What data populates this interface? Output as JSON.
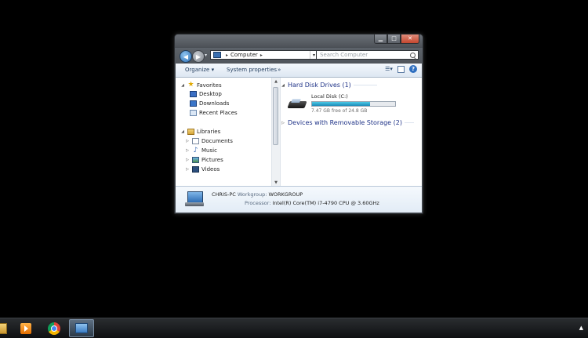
{
  "window": {
    "caption_buttons": {
      "minimize": "▁",
      "maximize": "□",
      "close": "✕"
    },
    "address": {
      "location": "Computer",
      "sep1": "▸",
      "sep2": "▸",
      "dropdown": "▾"
    },
    "search": {
      "placeholder": "Search Computer"
    },
    "toolbar": {
      "organize": "Organize ▾",
      "system_properties": "System properties",
      "more": "»"
    },
    "nav": {
      "favorites": {
        "label": "Favorites",
        "items": [
          "Desktop",
          "Downloads",
          "Recent Places"
        ]
      },
      "libraries": {
        "label": "Libraries",
        "items": [
          "Documents",
          "Music",
          "Pictures",
          "Videos"
        ]
      }
    },
    "content": {
      "hard_disk_group": "Hard Disk Drives (1)",
      "removable_group": "Devices with Removable Storage (2)",
      "drive": {
        "name": "Local Disk (C:)",
        "free_text": "7.47 GB free of 24.8 GB",
        "used_fraction": 0.7
      }
    },
    "details": {
      "computer_name": "CHRIS-PC",
      "workgroup_label": "Workgroup:",
      "workgroup_value": "WORKGROUP",
      "processor_label": "Processor:",
      "processor_value": "Intel(R) Core(TM) i7-4790 CPU @ 3.60GHz"
    }
  },
  "taskbar": {
    "tray_arrow": "▲"
  }
}
